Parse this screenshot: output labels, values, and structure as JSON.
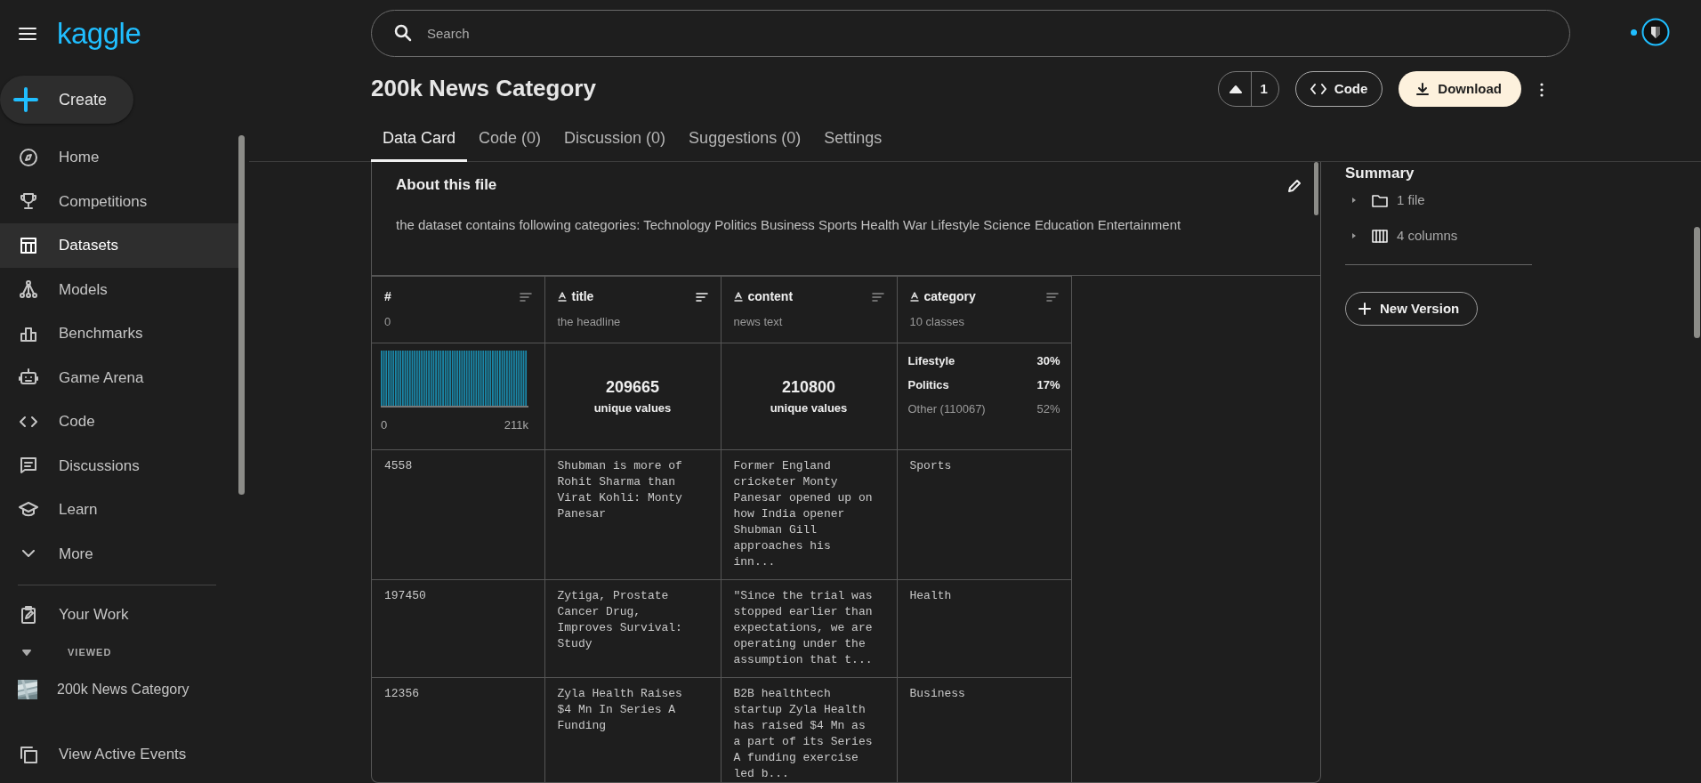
{
  "sidebar": {
    "logo": "kaggle",
    "create_label": "Create",
    "items": [
      {
        "label": "Home",
        "selected": false
      },
      {
        "label": "Competitions",
        "selected": false
      },
      {
        "label": "Datasets",
        "selected": true
      },
      {
        "label": "Models",
        "selected": false
      },
      {
        "label": "Benchmarks",
        "selected": false
      },
      {
        "label": "Game Arena",
        "selected": false
      },
      {
        "label": "Code",
        "selected": false
      },
      {
        "label": "Discussions",
        "selected": false
      },
      {
        "label": "Learn",
        "selected": false
      },
      {
        "label": "More",
        "selected": false
      }
    ],
    "your_work": "Your Work",
    "viewed_heading": "VIEWED",
    "viewed_expanded": true,
    "viewed": [
      {
        "label": "200k News Category"
      }
    ],
    "footer": "View Active Events"
  },
  "search": {
    "placeholder": "Search"
  },
  "dataset": {
    "title": "200k News Category",
    "votes": "1",
    "code_button": "Code",
    "download_button": "Download"
  },
  "tabs": [
    {
      "label": "Data Card",
      "selected": true
    },
    {
      "label": "Code (0)",
      "selected": false
    },
    {
      "label": "Discussion (0)",
      "selected": false
    },
    {
      "label": "Suggestions (0)",
      "selected": false
    },
    {
      "label": "Settings",
      "selected": false
    }
  ],
  "about": {
    "heading": "About this file",
    "description": "the dataset contains following categories: Technology Politics Business Sports Health War Lifestyle Science Education Entertainment"
  },
  "table": {
    "columns": [
      {
        "name": "#",
        "kind": "numeric",
        "description": "0",
        "sorted": false,
        "summary": {
          "kind": "histogram",
          "min_label": "0",
          "max_label": "211k"
        }
      },
      {
        "name": "title",
        "kind": "string",
        "description": "the headline",
        "sorted": true,
        "summary": {
          "kind": "unique",
          "value": "209665",
          "label": "unique values"
        }
      },
      {
        "name": "content",
        "kind": "string",
        "description": "news text",
        "sorted": false,
        "summary": {
          "kind": "unique",
          "value": "210800",
          "label": "unique values"
        }
      },
      {
        "name": "category",
        "kind": "string",
        "description": "10 classes",
        "sorted": false,
        "summary": {
          "kind": "categories",
          "categories": [
            {
              "label": "Lifestyle",
              "pct": "30%",
              "kind": "top"
            },
            {
              "label": "Politics",
              "pct": "17%",
              "kind": "top"
            },
            {
              "label": "Other (110067)",
              "pct": "52%",
              "kind": "other"
            }
          ]
        }
      }
    ],
    "rows": [
      [
        "4558",
        "Shubman is more of Rohit Sharma than Virat Kohli: Monty Panesar",
        "Former England cricketer Monty Panesar opened up on how India opener Shubman Gill approaches his inn...",
        "Sports"
      ],
      [
        "197450",
        "Zytiga, Prostate Cancer Drug, Improves Survival: Study",
        "\"Since the trial was stopped earlier than expectations, we are operating under the assumption that t...",
        "Health"
      ],
      [
        "12356",
        "Zyla Health Raises $4 Mn In Series A Funding",
        "B2B healthtech startup Zyla Health has raised $4 Mn as a part of its Series A funding exercise led b...",
        "Business"
      ]
    ]
  },
  "summary_panel": {
    "heading": "Summary",
    "items": [
      {
        "label": "1 file",
        "expanded": false
      },
      {
        "label": "4 columns",
        "expanded": false
      }
    ],
    "new_version": "New Version"
  }
}
